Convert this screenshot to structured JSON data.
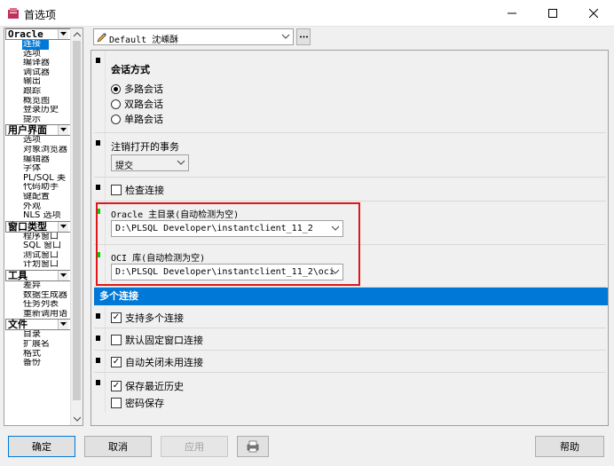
{
  "window": {
    "title": "首选项",
    "controls": {
      "minimize": "minimize-icon",
      "maximize": "maximize-icon",
      "close": "close-icon"
    }
  },
  "nav": {
    "categories": [
      {
        "label": "Oracle",
        "items": [
          "连接",
          "选项",
          "编译器",
          "调试器",
          "输出",
          "跟踪",
          "概览图",
          "登录历史",
          "提示"
        ]
      },
      {
        "label": "用户界面",
        "items": [
          "选项",
          "对象浏览器",
          "编辑器",
          "字体",
          "PL/SQL 美",
          "代码助手",
          "键配置",
          "外观",
          "NLS 选项"
        ]
      },
      {
        "label": "窗口类型",
        "items": [
          "程序窗口",
          "SQL 窗口",
          "测试窗口",
          "计划窗口"
        ]
      },
      {
        "label": "工具",
        "items": [
          "差异",
          "数据生成器",
          "任务列表",
          "重新调用语"
        ]
      },
      {
        "label": "文件",
        "items": [
          "目录",
          "扩展名",
          "格式",
          "备份"
        ]
      }
    ],
    "selected": "连接"
  },
  "profile": {
    "value": "Default 沈嵊酥"
  },
  "panel": {
    "session": {
      "title": "会话方式",
      "options": [
        "多路会话",
        "双路会话",
        "单路会话"
      ],
      "selected_index": 0
    },
    "logout": {
      "label": "注销打开的事务",
      "value": "提交"
    },
    "check_connection": {
      "label": "检查连接",
      "checked": false
    },
    "oracle_home": {
      "label": "Oracle 主目录(自动检测为空)",
      "value": "D:\\PLSQL Developer\\instantclient_11_2"
    },
    "oci_lib": {
      "label": "OCI 库(自动检测为空)",
      "value": "D:\\PLSQL Developer\\instantclient_11_2\\oci"
    },
    "multi_header": "多个连接",
    "multi_support": {
      "label": "支持多个连接",
      "checked": true
    },
    "default_fixed": {
      "label": "默认固定窗口连接",
      "checked": false
    },
    "auto_close": {
      "label": "自动关闭未用连接",
      "checked": true
    },
    "save_history": {
      "label": "保存最近历史",
      "checked": true
    },
    "save_password": {
      "label": "密码保存",
      "checked": false
    }
  },
  "buttons": {
    "ok": "确定",
    "cancel": "取消",
    "apply": "应用",
    "help": "帮助"
  }
}
